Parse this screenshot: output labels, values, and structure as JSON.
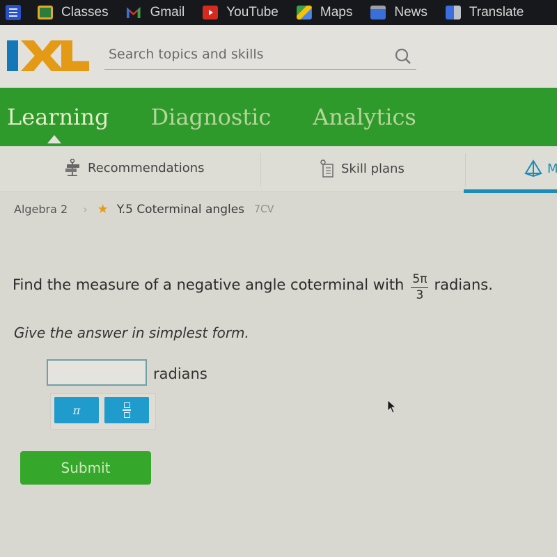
{
  "bookmarks": {
    "items": [
      {
        "label": "Classes",
        "icon": "google-classroom-icon"
      },
      {
        "label": "Gmail",
        "icon": "gmail-icon"
      },
      {
        "label": "YouTube",
        "icon": "youtube-icon"
      },
      {
        "label": "Maps",
        "icon": "maps-icon"
      },
      {
        "label": "News",
        "icon": "news-icon"
      },
      {
        "label": "Translate",
        "icon": "translate-icon"
      }
    ]
  },
  "header": {
    "logo": "IXL",
    "search": {
      "placeholder": "Search topics and skills",
      "value": ""
    }
  },
  "nav": {
    "tabs": [
      {
        "label": "Learning",
        "active": true
      },
      {
        "label": "Diagnostic",
        "active": false
      },
      {
        "label": "Analytics",
        "active": false
      }
    ]
  },
  "subnav": {
    "items": [
      {
        "label": "Recommendations",
        "icon": "signpost-icon"
      },
      {
        "label": "Skill plans",
        "icon": "clipboard-icon"
      },
      {
        "label": "M",
        "icon": "pyramid-icon",
        "active": true
      }
    ]
  },
  "breadcrumb": {
    "course": "Algebra 2",
    "skill": "Y.5 Coterminal angles",
    "code": "7CV"
  },
  "question": {
    "prompt_before": "Find the measure of a negative angle coterminal with",
    "fraction_numerator": "5π",
    "fraction_denominator": "3",
    "prompt_after": "radians.",
    "instruction": "Give the answer in simplest form."
  },
  "answer": {
    "value": "",
    "unit": "radians",
    "keypad": {
      "pi_key": "π"
    }
  },
  "submit_label": "Submit",
  "colors": {
    "nav_green": "#2f9a2c",
    "accent_blue": "#1f9ccc",
    "logo_blue": "#1478b8",
    "logo_orange": "#e59a16",
    "submit_green": "#35a82c"
  }
}
